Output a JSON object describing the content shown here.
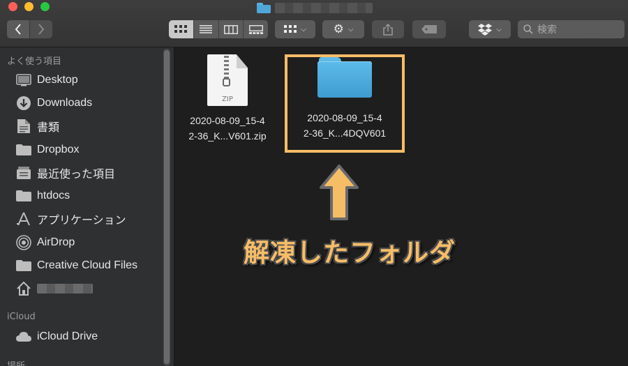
{
  "window": {
    "controls": [
      "close",
      "minimize",
      "maximize"
    ]
  },
  "toolbar": {
    "back_icon": "chevron-left-icon",
    "forward_icon": "chevron-right-icon",
    "view_modes": [
      "icon",
      "list",
      "column",
      "gallery"
    ],
    "active_view": "icon",
    "search_placeholder": "検索"
  },
  "sidebar": {
    "favorites_header": "よく使う項目",
    "favorites": [
      {
        "label": "Desktop",
        "icon": "desktop-icon"
      },
      {
        "label": "Downloads",
        "icon": "downloads-icon"
      },
      {
        "label": "書類",
        "icon": "document-icon"
      },
      {
        "label": "Dropbox",
        "icon": "folder-icon"
      },
      {
        "label": "最近使った項目",
        "icon": "recents-icon"
      },
      {
        "label": "htdocs",
        "icon": "folder-icon"
      },
      {
        "label": "アプリケーション",
        "icon": "applications-icon"
      },
      {
        "label": "AirDrop",
        "icon": "airdrop-icon"
      },
      {
        "label": "Creative Cloud Files",
        "icon": "folder-icon"
      },
      {
        "label": "",
        "icon": "home-icon"
      }
    ],
    "icloud_header": "iCloud",
    "icloud_items": [
      {
        "label": "iCloud Drive",
        "icon": "cloud-icon"
      }
    ],
    "locations_header": "場所"
  },
  "content": {
    "files": [
      {
        "name": "2020-08-09_15-4\n2-36_K...V601.zip",
        "type": "zip",
        "icon_label": "ZIP"
      },
      {
        "name": "2020-08-09_15-4\n2-36_K...4DQV601",
        "type": "folder"
      }
    ],
    "annotation": "解凍したフォルダ",
    "colors": {
      "highlight": "#f6bd67",
      "folder": "#4fa7d8"
    }
  }
}
